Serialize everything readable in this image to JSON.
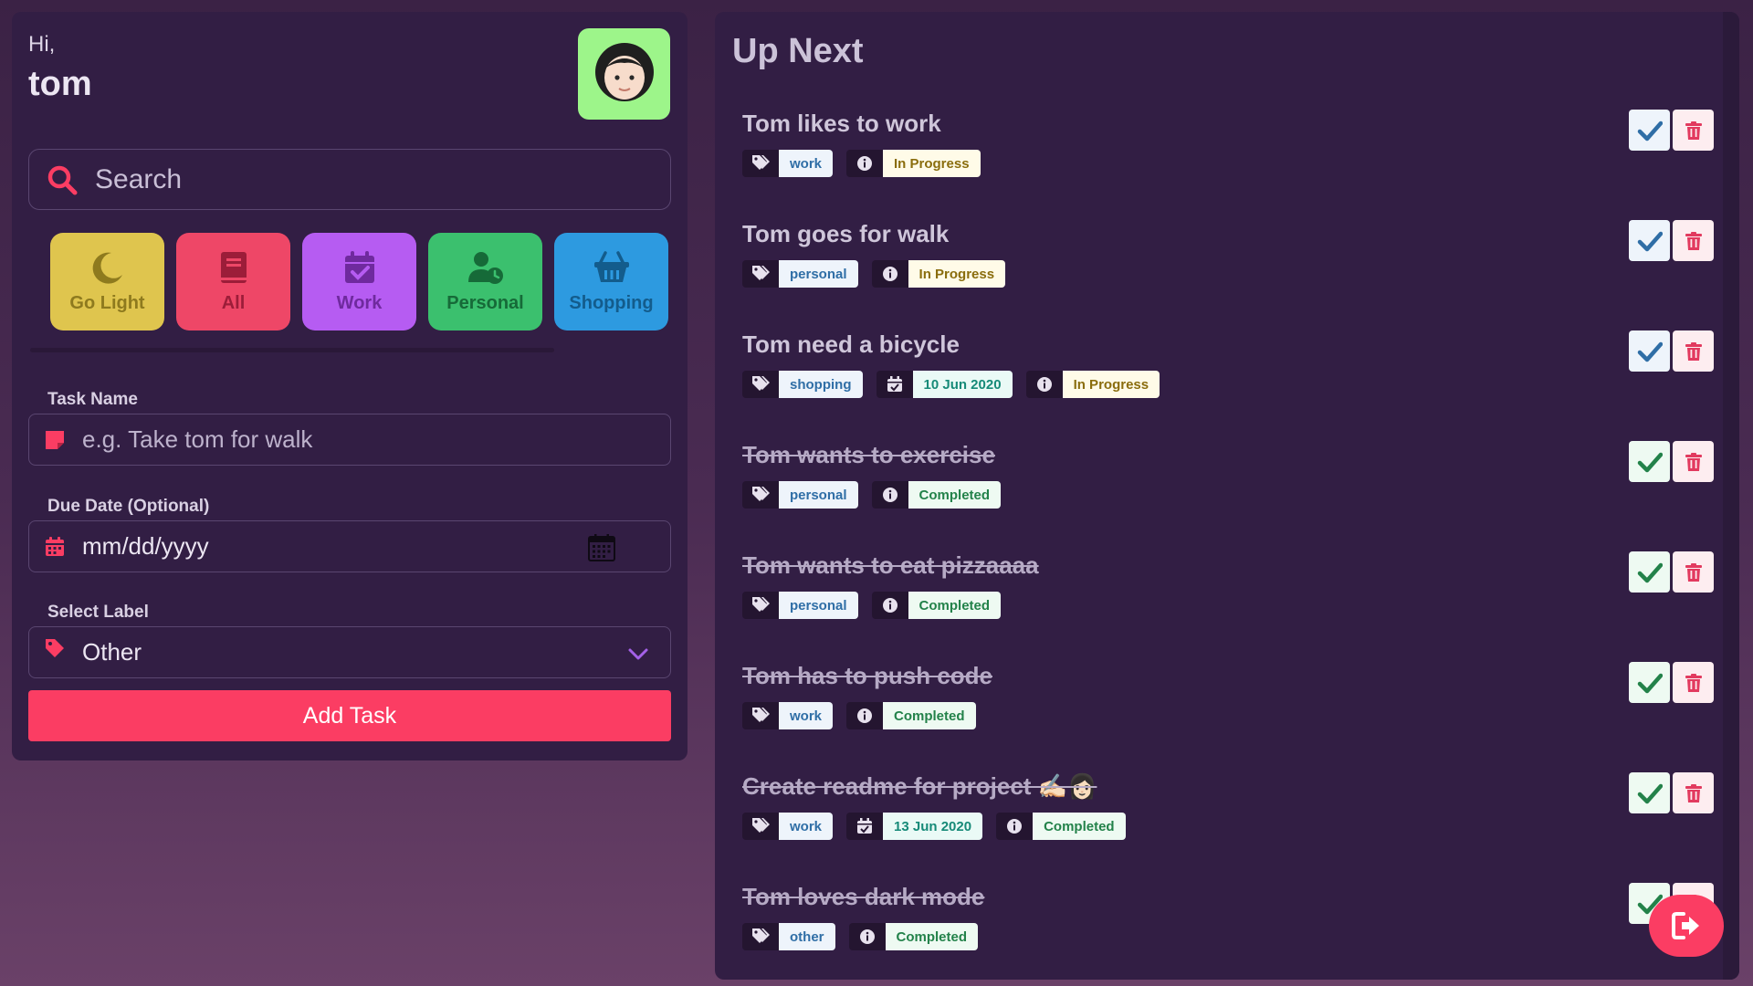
{
  "user": {
    "greeting": "Hi,",
    "name": "tom"
  },
  "search": {
    "placeholder": "Search"
  },
  "filters": [
    {
      "label": "Go Light",
      "icon": "moon-icon"
    },
    {
      "label": "All",
      "icon": "book-icon"
    },
    {
      "label": "Work",
      "icon": "calendar-check-icon"
    },
    {
      "label": "Personal",
      "icon": "user-clock-icon"
    },
    {
      "label": "Shopping",
      "icon": "basket-icon"
    }
  ],
  "form": {
    "task_name_label": "Task Name",
    "task_name_placeholder": "e.g. Take tom for walk",
    "due_date_label": "Due Date (Optional)",
    "due_date_placeholder": "mm/dd/yyyy",
    "select_label_label": "Select Label",
    "select_label_value": "Other",
    "add_button": "Add Task"
  },
  "main": {
    "title": "Up Next"
  },
  "tasks": [
    {
      "title": "Tom likes to work",
      "label": "work",
      "date": null,
      "status": "In Progress",
      "done": false
    },
    {
      "title": "Tom goes for walk",
      "label": "personal",
      "date": null,
      "status": "In Progress",
      "done": false
    },
    {
      "title": "Tom need a bicycle",
      "label": "shopping",
      "date": "10 Jun 2020",
      "status": "In Progress",
      "done": false
    },
    {
      "title": "Tom wants to exercise",
      "label": "personal",
      "date": null,
      "status": "Completed",
      "done": true
    },
    {
      "title": "Tom wants to eat pizzaaaa",
      "label": "personal",
      "date": null,
      "status": "Completed",
      "done": true
    },
    {
      "title": "Tom has to push code",
      "label": "work",
      "date": null,
      "status": "Completed",
      "done": true
    },
    {
      "title": "Create readme for project ✍🏻👩🏻",
      "label": "work",
      "date": "13 Jun 2020",
      "status": "Completed",
      "done": true
    },
    {
      "title": "Tom loves dark mode",
      "label": "other",
      "date": null,
      "status": "Completed",
      "done": true
    }
  ],
  "colors": {
    "accent": "#fb3d63",
    "panel_bg": "#321e44",
    "go_light": "#dfc54e",
    "all": "#ee4767",
    "work": "#b65cf2",
    "personal": "#3bc06e",
    "shopping": "#2d9ae0"
  }
}
